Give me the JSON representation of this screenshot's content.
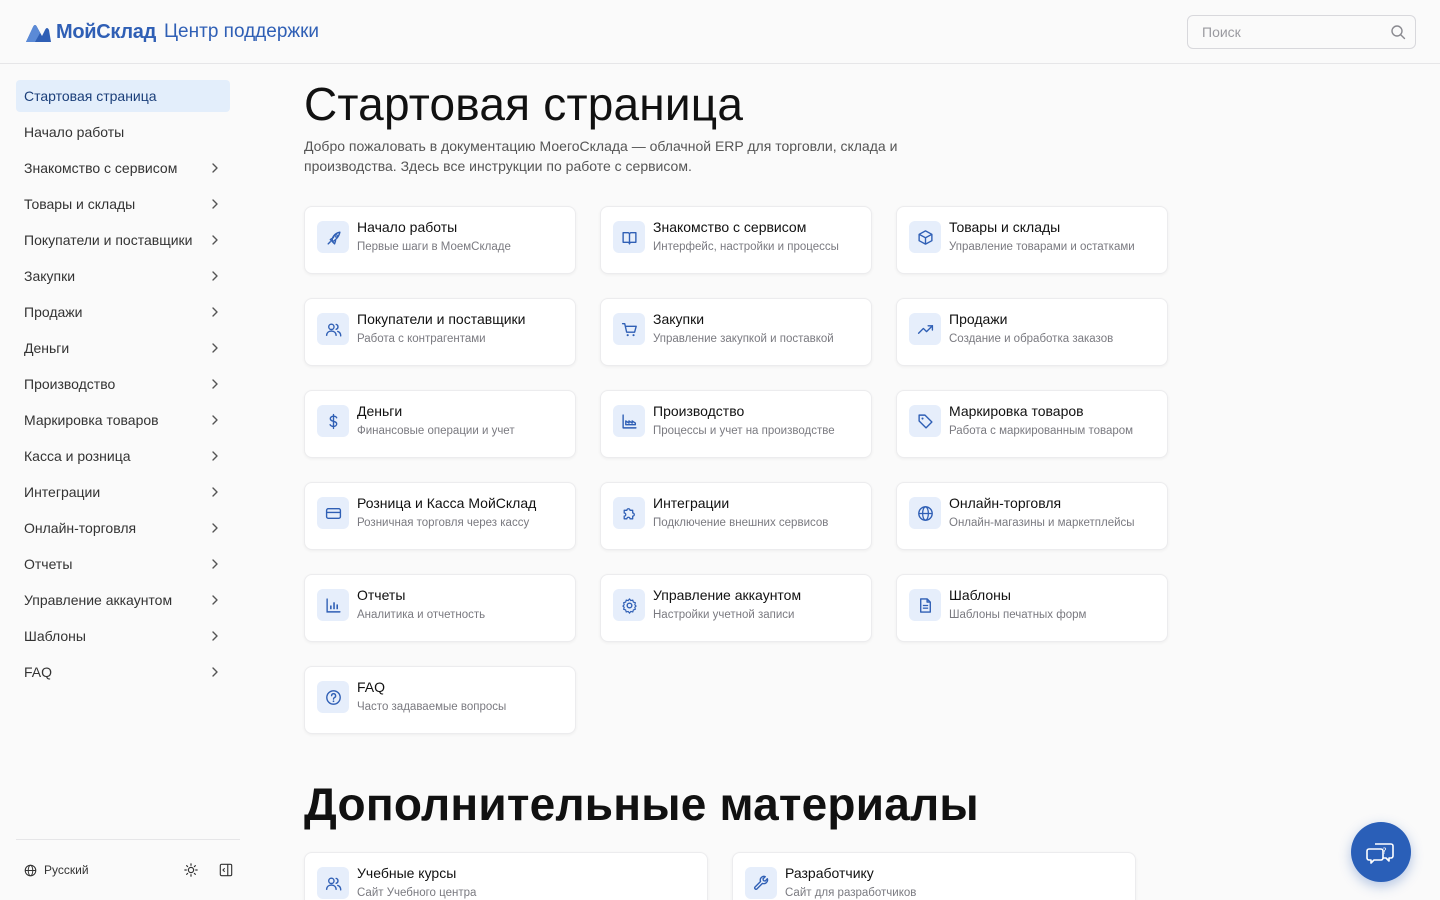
{
  "header": {
    "brand": "МойСклад",
    "subtitle": "Центр поддержки",
    "search_placeholder": "Поиск"
  },
  "sidebar": {
    "items": [
      {
        "label": "Стартовая страница",
        "active": true,
        "chevron": false
      },
      {
        "label": "Начало работы",
        "chevron": false
      },
      {
        "label": "Знакомство с сервисом",
        "chevron": true
      },
      {
        "label": "Товары и склады",
        "chevron": true
      },
      {
        "label": "Покупатели и поставщики",
        "chevron": true
      },
      {
        "label": "Закупки",
        "chevron": true
      },
      {
        "label": "Продажи",
        "chevron": true
      },
      {
        "label": "Деньги",
        "chevron": true
      },
      {
        "label": "Производство",
        "chevron": true
      },
      {
        "label": "Маркировка товаров",
        "chevron": true
      },
      {
        "label": "Касса и розница",
        "chevron": true
      },
      {
        "label": "Интеграции",
        "chevron": true
      },
      {
        "label": "Онлайн-торговля",
        "chevron": true
      },
      {
        "label": "Отчеты",
        "chevron": true
      },
      {
        "label": "Управление аккаунтом",
        "chevron": true
      },
      {
        "label": "Шаблоны",
        "chevron": true
      },
      {
        "label": "FAQ",
        "chevron": true
      }
    ],
    "footer": {
      "language": "Русский"
    }
  },
  "main": {
    "title": "Стартовая страница",
    "intro": "Добро пожаловать в документацию МоегоСклада — облачной ERP для торговли, склада и производства. Здесь все инструкции по работе с сервисом.",
    "cards": [
      {
        "title": "Начало работы",
        "desc": "Первые шаги в МоемСкладе",
        "icon": "rocket-icon"
      },
      {
        "title": "Знакомство с сервисом",
        "desc": "Интерфейс, настройки и процессы",
        "icon": "book-icon"
      },
      {
        "title": "Товары и склады",
        "desc": "Управление товарами и остатками",
        "icon": "box-icon"
      },
      {
        "title": "Покупатели и поставщики",
        "desc": "Работа с контрагентами",
        "icon": "users-icon"
      },
      {
        "title": "Закупки",
        "desc": "Управление закупкой и поставкой",
        "icon": "cart-icon"
      },
      {
        "title": "Продажи",
        "desc": "Создание и обработка заказов",
        "icon": "trend-icon"
      },
      {
        "title": "Деньги",
        "desc": "Финансовые операции и учет",
        "icon": "dollar-icon"
      },
      {
        "title": "Производство",
        "desc": "Процессы и учет на производстве",
        "icon": "factory-icon"
      },
      {
        "title": "Маркировка товаров",
        "desc": "Работа с маркированным товаром",
        "icon": "tag-icon"
      },
      {
        "title": "Розница и Касса МойСклад",
        "desc": "Розничная торговля через кассу",
        "icon": "card-icon"
      },
      {
        "title": "Интеграции",
        "desc": "Подключение внешних сервисов",
        "icon": "puzzle-icon"
      },
      {
        "title": "Онлайн-торговля",
        "desc": "Онлайн-магазины и маркетплейсы",
        "icon": "globe-icon"
      },
      {
        "title": "Отчеты",
        "desc": "Аналитика и отчетность",
        "icon": "bar-chart-icon"
      },
      {
        "title": "Управление аккаунтом",
        "desc": "Настройки учетной записи",
        "icon": "gear-icon"
      },
      {
        "title": "Шаблоны",
        "desc": "Шаблоны печатных форм",
        "icon": "document-icon"
      },
      {
        "title": "FAQ",
        "desc": "Часто задаваемые вопросы",
        "icon": "question-icon"
      }
    ],
    "extra_title": "Дополнительные материалы",
    "extra_cards": [
      {
        "title": "Учебные курсы",
        "desc": "Сайт Учебного центра",
        "icon": "users-icon"
      },
      {
        "title": "Разработчику",
        "desc": "Сайт для разработчиков",
        "icon": "wrench-icon"
      }
    ]
  },
  "colors": {
    "accent": "#2f5fb5",
    "active_bg": "#e3eefb",
    "chat_button": "#2a5fb8"
  }
}
